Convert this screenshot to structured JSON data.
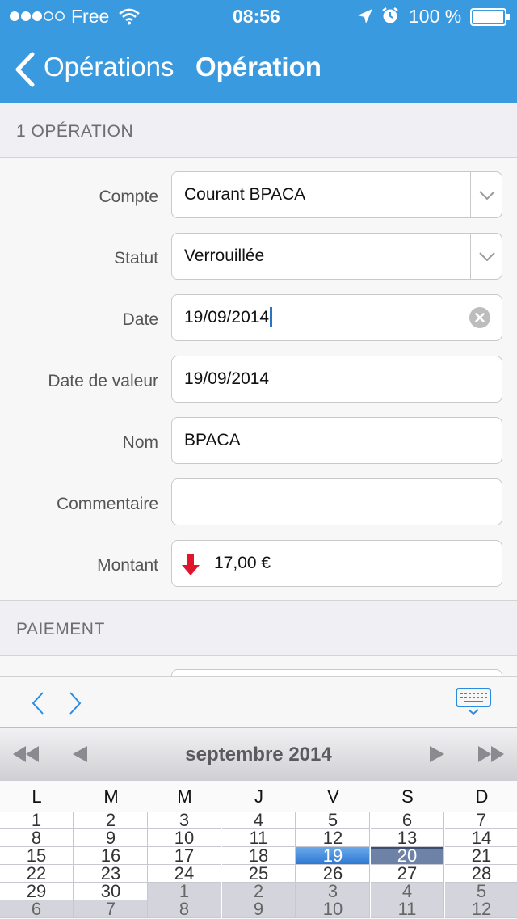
{
  "status_bar": {
    "carrier": "Free",
    "time": "08:56",
    "battery": "100 %"
  },
  "nav": {
    "back_label": "Opérations",
    "title": "Opération"
  },
  "sections": {
    "operation": "1 OPÉRATION",
    "payment": "PAIEMENT"
  },
  "form": {
    "account": {
      "label": "Compte",
      "value": "Courant BPACA"
    },
    "status": {
      "label": "Statut",
      "value": "Verrouillée"
    },
    "date": {
      "label": "Date",
      "value": "19/09/2014"
    },
    "value_date": {
      "label": "Date de valeur",
      "value": "19/09/2014"
    },
    "name": {
      "label": "Nom",
      "value": "BPACA"
    },
    "comment": {
      "label": "Commentaire",
      "value": ""
    },
    "amount": {
      "label": "Montant",
      "value": "17,00 €",
      "direction": "debit"
    }
  },
  "calendar": {
    "month_label": "septembre 2014",
    "weekdays": [
      "L",
      "M",
      "M",
      "J",
      "V",
      "S",
      "D"
    ],
    "weeks": [
      [
        "1",
        "2",
        "3",
        "4",
        "5",
        "6",
        "7"
      ],
      [
        "8",
        "9",
        "10",
        "11",
        "12",
        "13",
        "14"
      ],
      [
        "15",
        "16",
        "17",
        "18",
        "19",
        "20",
        "21"
      ],
      [
        "22",
        "23",
        "24",
        "25",
        "26",
        "27",
        "28"
      ],
      [
        "29",
        "30",
        "1",
        "2",
        "3",
        "4",
        "5"
      ],
      [
        "6",
        "7",
        "8",
        "9",
        "10",
        "11",
        "12"
      ]
    ],
    "selected_day": "19",
    "today": "20"
  },
  "colors": {
    "nav_bg": "#3a9ae0",
    "accent": "#2a8ce0",
    "debit_arrow": "#e0142a"
  }
}
